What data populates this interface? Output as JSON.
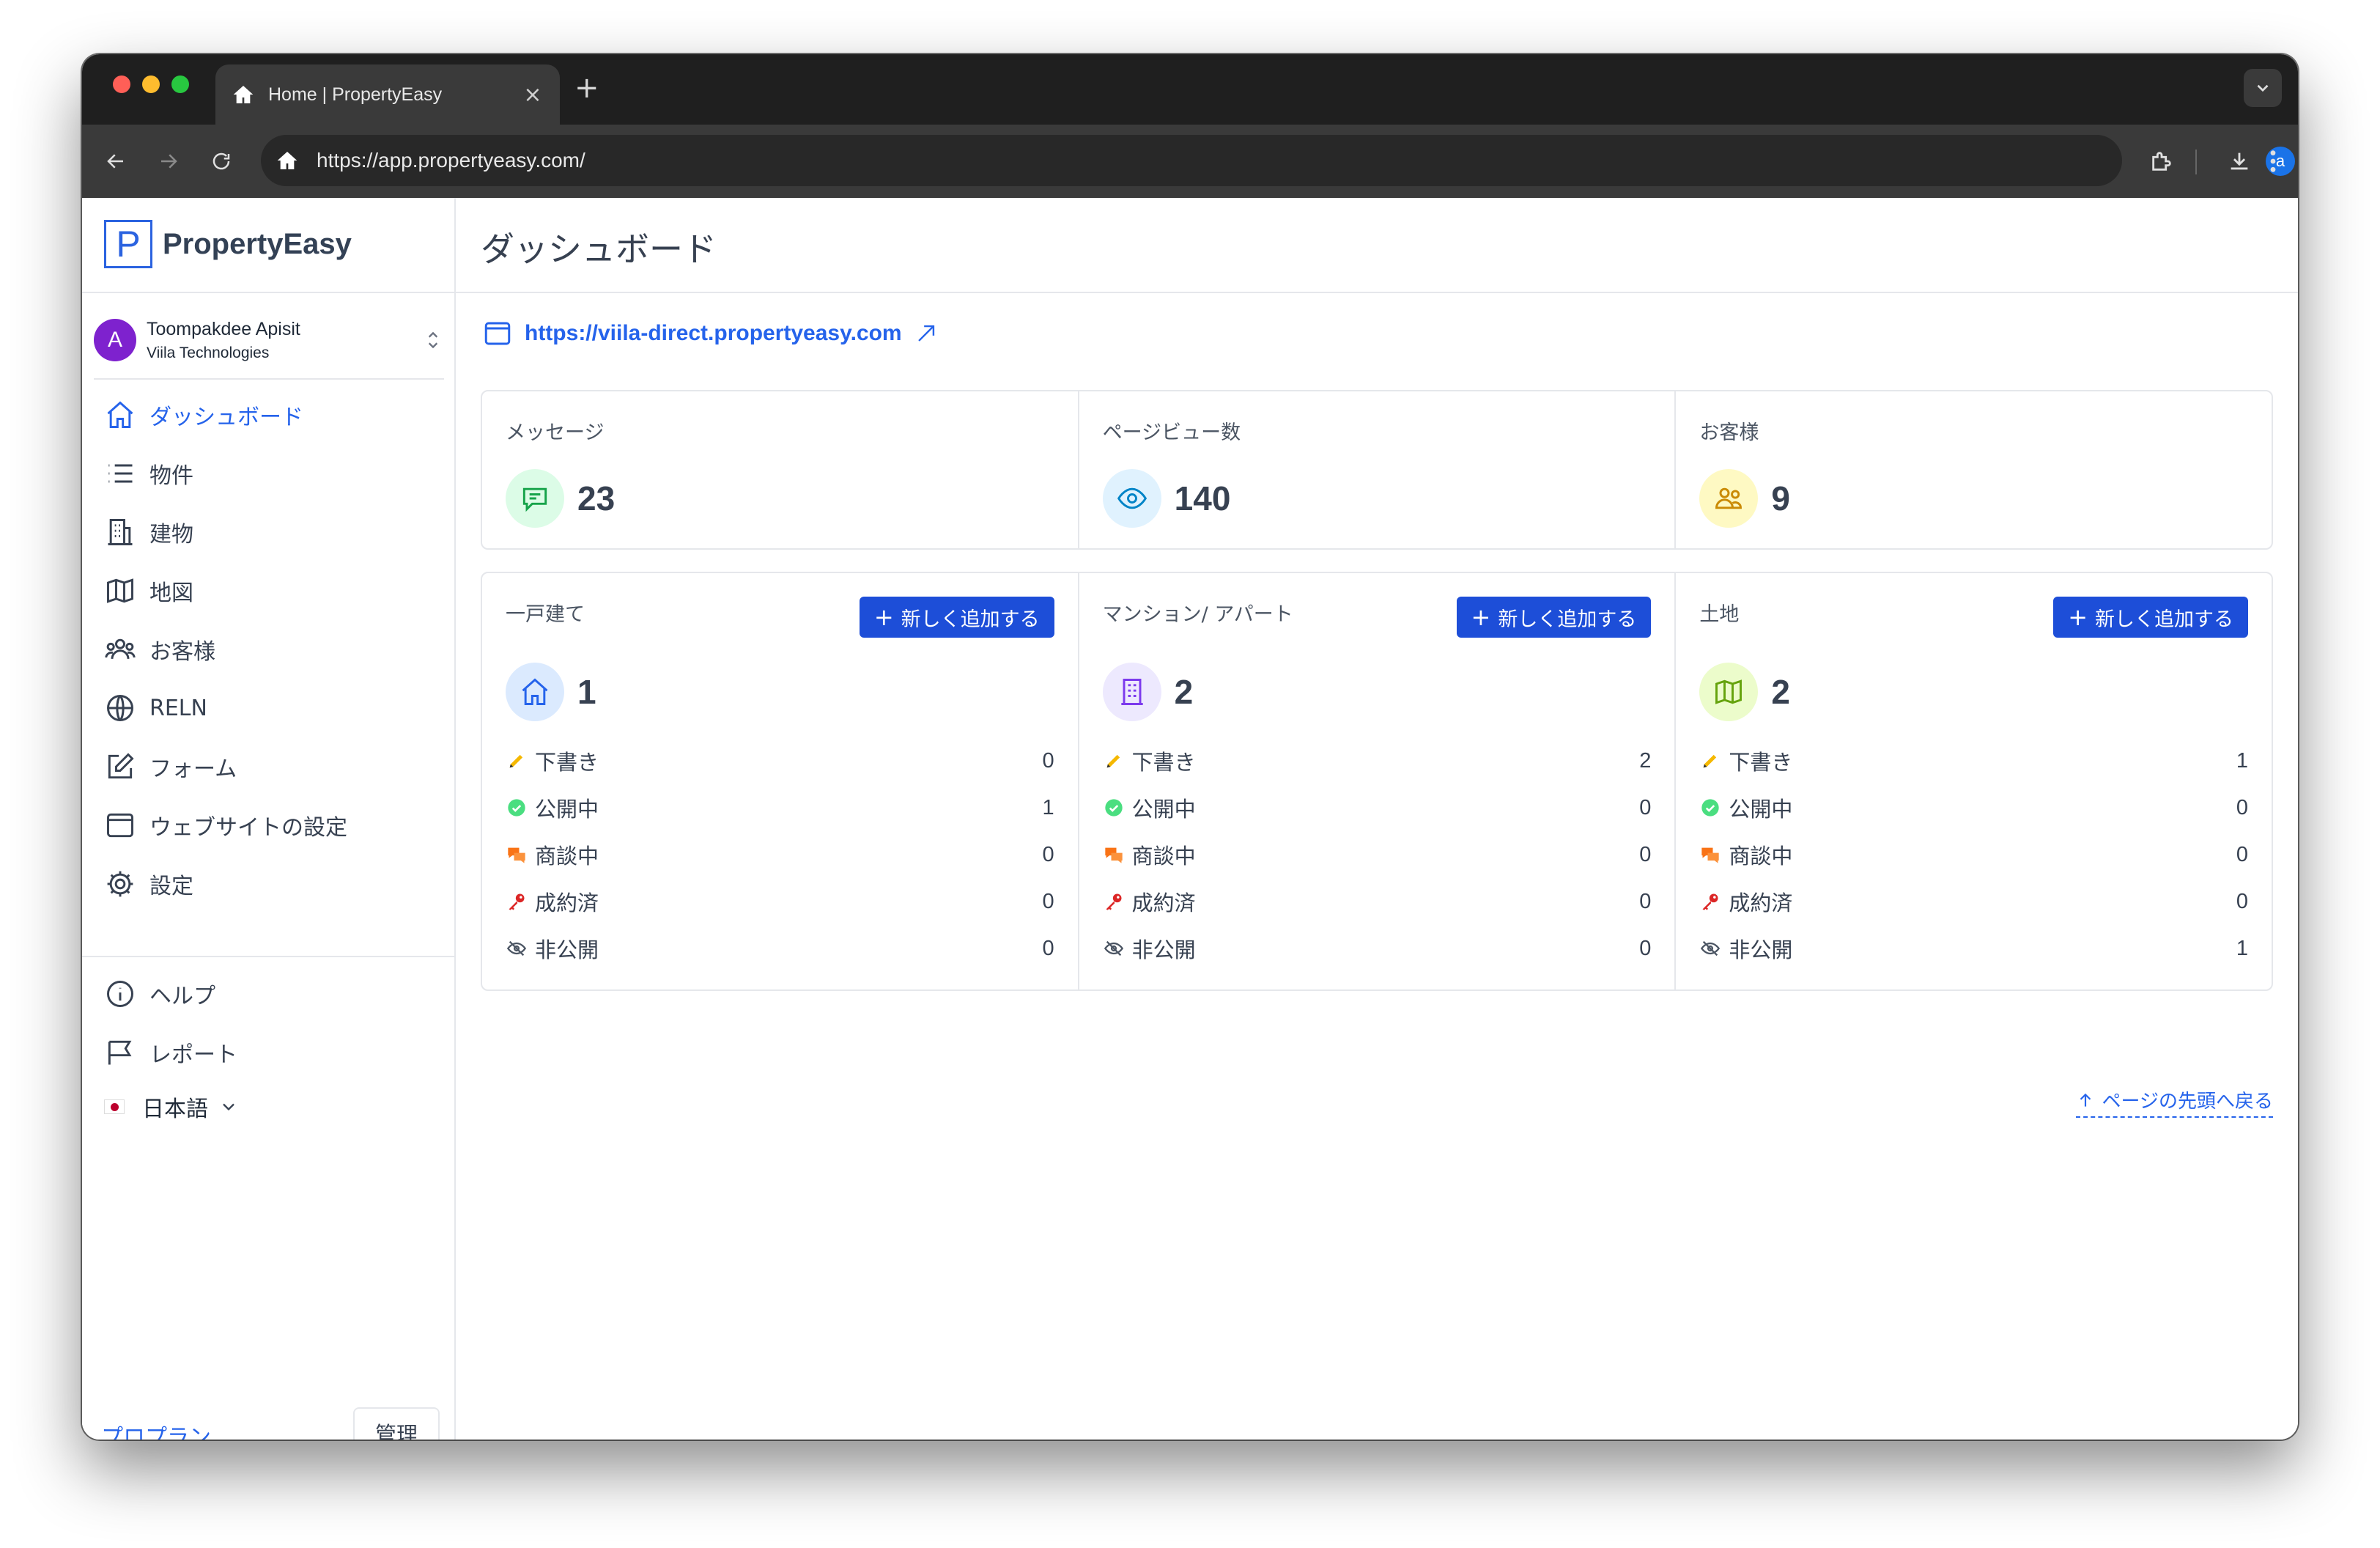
{
  "browser": {
    "tab_title": "Home | PropertyEasy",
    "url": "https://app.propertyeasy.com/",
    "profile_initial": "a"
  },
  "sidebar": {
    "brand": "PropertyEasy",
    "brand_letter": "P",
    "user": {
      "initial": "A",
      "name": "Toompakdee Apisit",
      "org": "Viila Technologies"
    },
    "nav": [
      {
        "label": "ダッシュボード",
        "icon": "home-icon",
        "active": true
      },
      {
        "label": "物件",
        "icon": "list-icon"
      },
      {
        "label": "建物",
        "icon": "building-icon"
      },
      {
        "label": "地図",
        "icon": "map-icon"
      },
      {
        "label": "お客様",
        "icon": "users-icon"
      },
      {
        "label": "RELN",
        "icon": "globe-icon"
      },
      {
        "label": "フォーム",
        "icon": "edit-icon"
      },
      {
        "label": "ウェブサイトの設定",
        "icon": "browser-window-icon"
      },
      {
        "label": "設定",
        "icon": "gear-icon"
      }
    ],
    "nav2": [
      {
        "label": "ヘルプ",
        "icon": "info-icon"
      },
      {
        "label": "レポート",
        "icon": "flag-icon"
      }
    ],
    "language": "日本語",
    "plan_label": "プロプラン",
    "manage_label": "管理"
  },
  "main": {
    "title": "ダッシュボード",
    "site_url": "https://viila-direct.propertyeasy.com",
    "stats": [
      {
        "label": "メッセージ",
        "value": "23",
        "icon": "chat-icon",
        "color": "#16a34a",
        "bg": "#dcfce7"
      },
      {
        "label": "ページビュー数",
        "value": "140",
        "icon": "eye-icon",
        "color": "#0284c7",
        "bg": "#e0f2fe"
      },
      {
        "label": "お客様",
        "value": "9",
        "icon": "users-icon",
        "color": "#ca8a04",
        "bg": "#fef9c3"
      }
    ],
    "add_label": "新しく追加する",
    "property_types": [
      {
        "label": "一戸建て",
        "value": "1",
        "icon": "home-icon",
        "color": "#2563eb",
        "bg": "#dbeafe",
        "statuses": [
          {
            "label": "下書き",
            "count": "0"
          },
          {
            "label": "公開中",
            "count": "1"
          },
          {
            "label": "商談中",
            "count": "0"
          },
          {
            "label": "成約済",
            "count": "0"
          },
          {
            "label": "非公開",
            "count": "0"
          }
        ]
      },
      {
        "label": "マンション/ アパート",
        "value": "2",
        "icon": "building-icon",
        "color": "#7c3aed",
        "bg": "#ede9fe",
        "statuses": [
          {
            "label": "下書き",
            "count": "2"
          },
          {
            "label": "公開中",
            "count": "0"
          },
          {
            "label": "商談中",
            "count": "0"
          },
          {
            "label": "成約済",
            "count": "0"
          },
          {
            "label": "非公開",
            "count": "0"
          }
        ]
      },
      {
        "label": "土地",
        "value": "2",
        "icon": "map-icon",
        "color": "#65a30d",
        "bg": "#ecfccb",
        "statuses": [
          {
            "label": "下書き",
            "count": "1"
          },
          {
            "label": "公開中",
            "count": "0"
          },
          {
            "label": "商談中",
            "count": "0"
          },
          {
            "label": "成約済",
            "count": "0"
          },
          {
            "label": "非公開",
            "count": "1"
          }
        ]
      }
    ],
    "back_to_top": "ページの先頭へ戻る"
  }
}
